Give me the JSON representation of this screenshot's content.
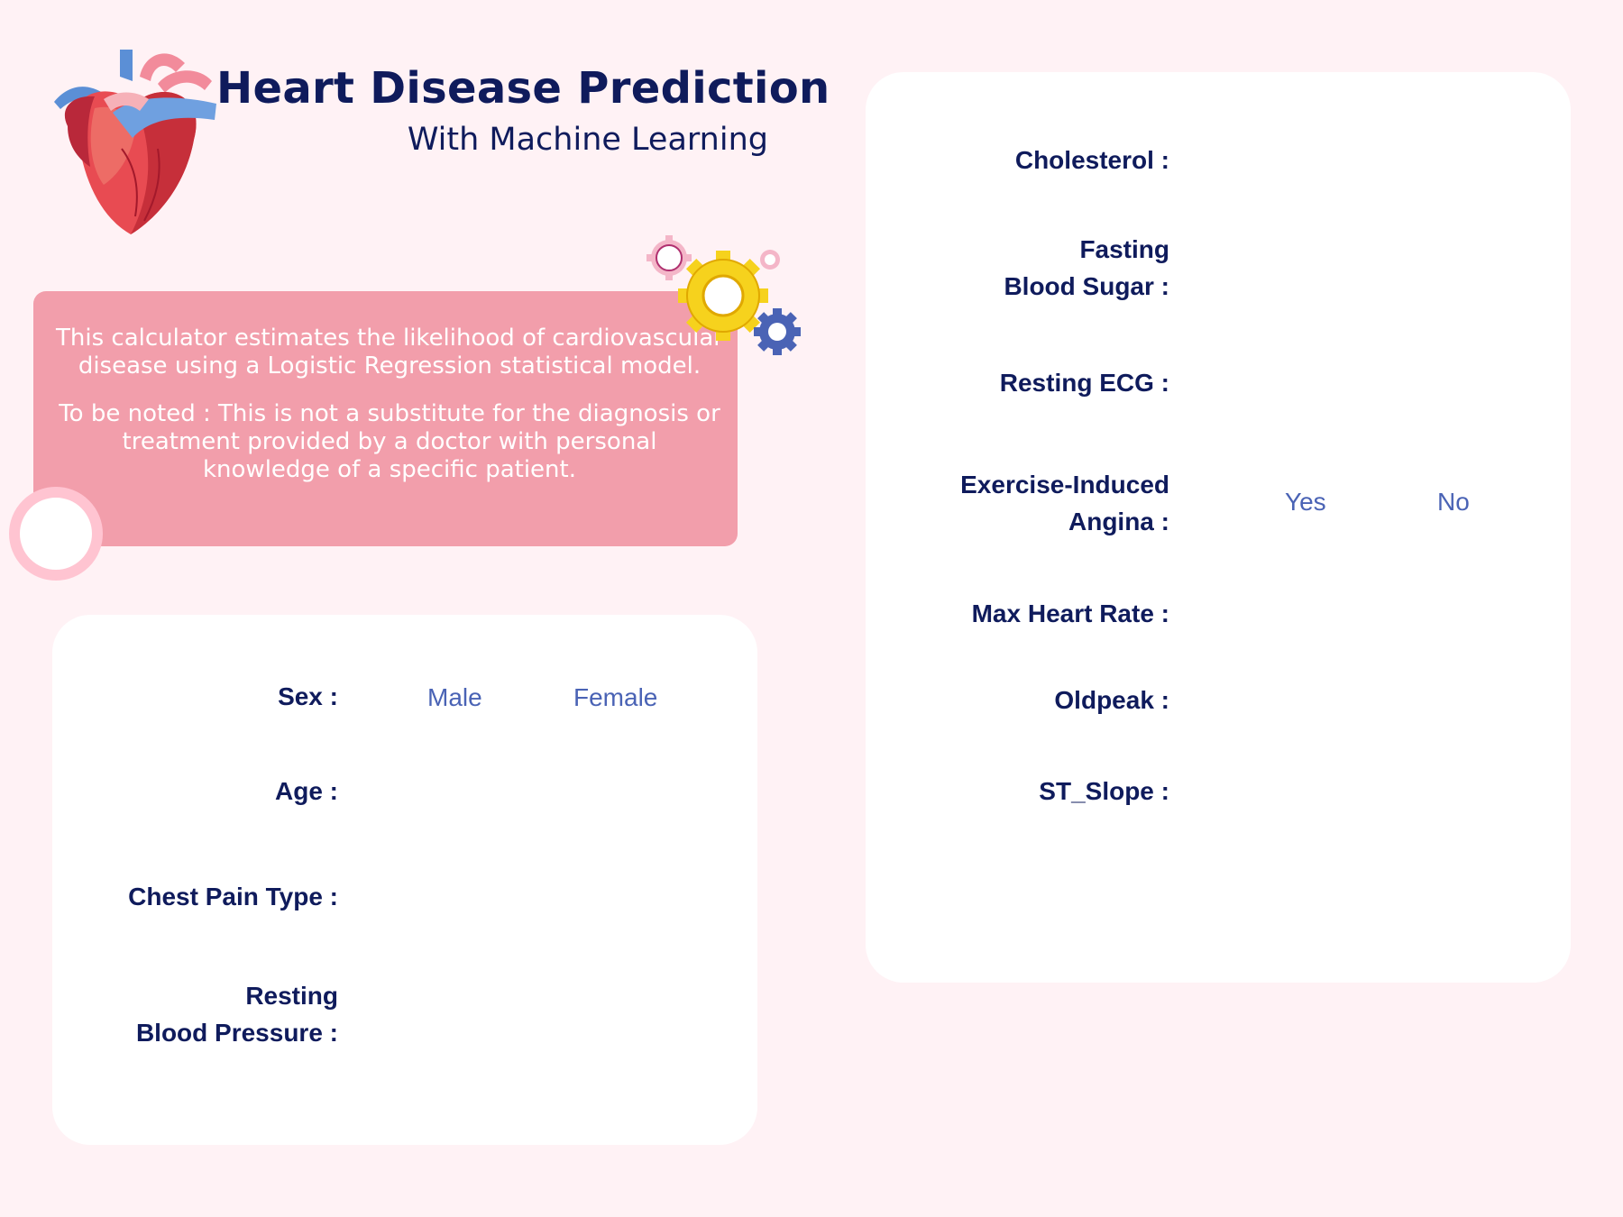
{
  "header": {
    "title": "Heart Disease Prediction",
    "subtitle": "With Machine Learning"
  },
  "info": {
    "paragraph1": "This calculator estimates the likelihood of cardiovascular disease using a Logistic Regression statistical model.",
    "paragraph2": "To be noted :  This is not a substitute for the diagnosis or treatment provided by a doctor with personal knowledge of a specific patient."
  },
  "left_form": {
    "sex_label": "Sex :",
    "sex_options": [
      "Male",
      "Female"
    ],
    "age_label": "Age :",
    "chest_pain_label": "Chest Pain Type :",
    "resting_bp_label_line1": "Resting",
    "resting_bp_label_line2": "Blood Pressure :"
  },
  "right_form": {
    "cholesterol_label": "Cholesterol :",
    "fasting_bs_label_line1": "Fasting",
    "fasting_bs_label_line2": "Blood Sugar :",
    "resting_ecg_label": "Resting ECG :",
    "angina_label_line1": "Exercise-Induced",
    "angina_label_line2": "Angina :",
    "angina_options": [
      "Yes",
      "No"
    ],
    "max_hr_label": "Max Heart Rate :",
    "oldpeak_label": "Oldpeak :",
    "st_slope_label": "ST_Slope :"
  },
  "colors": {
    "background": "#fff2f5",
    "navy": "#0f1b5c",
    "info_box": "#f29eab",
    "option_blue": "#4a63b5",
    "card": "#ffffff"
  },
  "icons": [
    "heart-illustration",
    "gears-icon",
    "ring-decoration"
  ]
}
